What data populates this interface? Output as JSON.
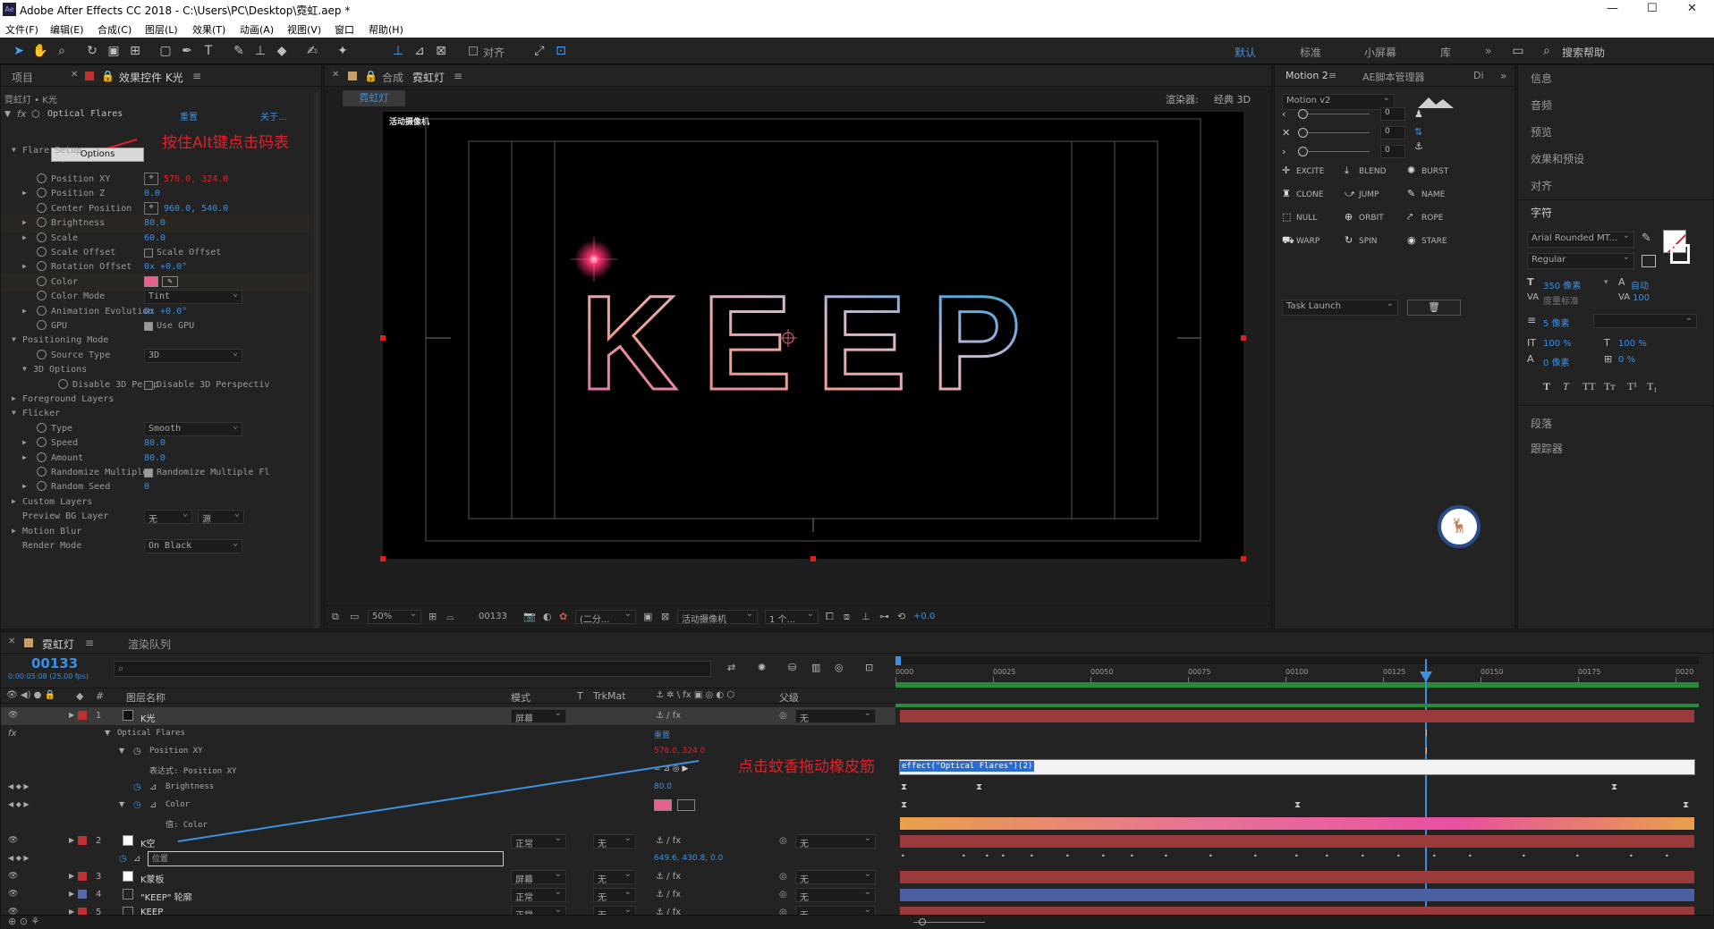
{
  "window": {
    "app_title": "Adobe After Effects CC 2018 - C:\\Users\\PC\\Desktop\\霓虹.aep *",
    "ae_logo": "Ae",
    "minimize": "—",
    "maximize": "☐",
    "close": "✕"
  },
  "menu": [
    "文件(F)",
    "编辑(E)",
    "合成(C)",
    "图层(L)",
    "效果(T)",
    "动画(A)",
    "视图(V)",
    "窗口",
    "帮助(H)"
  ],
  "toolbar": {
    "align_label": "对齐",
    "workspaces": [
      "默认",
      "标准",
      "小屏幕",
      "库"
    ],
    "active_workspace": "默认",
    "search_placeholder": "搜索帮助"
  },
  "effect_panel": {
    "tab_project": "项目",
    "tab_effects": "效果控件 K光",
    "breadcrumb": "霓虹灯 • K光",
    "effect_name": "Optical Flares",
    "reset": "重置",
    "about": "关于...",
    "annotation": "按住Alt键点击码表",
    "options_btn": "Options",
    "rows": [
      {
        "name": "Flare Setup",
        "indent": 1,
        "tw": "open"
      },
      {
        "name": "Position XY",
        "indent": 2,
        "value": "576.0, 324.0",
        "red": true,
        "target": true,
        "watch": true
      },
      {
        "name": "Position Z",
        "indent": 2,
        "tw": "closed",
        "value": "0.0",
        "watch": true
      },
      {
        "name": "Center Position",
        "indent": 2,
        "value": "960.0, 540.0",
        "target": true,
        "watch": true
      },
      {
        "name": "Brightness",
        "indent": 2,
        "tw": "closed",
        "value": "80.0",
        "watch": true,
        "hl": true
      },
      {
        "name": "Scale",
        "indent": 2,
        "tw": "closed",
        "value": "60.0",
        "watch": true
      },
      {
        "name": "Scale Offset",
        "indent": 2,
        "check": "Scale Offset",
        "watch": true
      },
      {
        "name": "Rotation Offset",
        "indent": 2,
        "tw": "closed",
        "value": "0x +0.0°",
        "watch": true
      },
      {
        "name": "Color",
        "indent": 2,
        "swatch": true,
        "watch": true,
        "hl": true
      },
      {
        "name": "Color Mode",
        "indent": 2,
        "select": "Tint",
        "watch": true
      },
      {
        "name": "Animation Evolution",
        "indent": 2,
        "tw": "closed",
        "value": "0x +0.0°",
        "watch": true
      },
      {
        "name": "GPU",
        "indent": 2,
        "check": "Use GPU",
        "on": true,
        "watch": true
      },
      {
        "name": "Positioning Mode",
        "indent": 1,
        "tw": "open"
      },
      {
        "name": "Source Type",
        "indent": 2,
        "select": "3D",
        "watch": true
      },
      {
        "name": "3D Options",
        "indent": 2,
        "tw": "open"
      },
      {
        "name": "Disable 3D Persp",
        "indent": 4,
        "check": "Disable 3D Perspectiv",
        "watch": true
      },
      {
        "name": "Foreground Layers",
        "indent": 1,
        "tw": "closed"
      },
      {
        "name": "Flicker",
        "indent": 1,
        "tw": "open"
      },
      {
        "name": "Type",
        "indent": 2,
        "select": "Smooth",
        "watch": true
      },
      {
        "name": "Speed",
        "indent": 2,
        "tw": "closed",
        "value": "80.0",
        "watch": true
      },
      {
        "name": "Amount",
        "indent": 2,
        "tw": "closed",
        "value": "80.0",
        "watch": true
      },
      {
        "name": "Randomize Multiple",
        "indent": 2,
        "check": "Randomize Multiple Fl",
        "on": true,
        "watch": true
      },
      {
        "name": "Random Seed",
        "indent": 2,
        "tw": "closed",
        "value": "0",
        "watch": true
      },
      {
        "name": "Custom Layers",
        "indent": 1,
        "tw": "closed"
      },
      {
        "name": "Preview BG Layer",
        "indent": 1,
        "select": "无",
        "select2": "源"
      },
      {
        "name": "Motion Blur",
        "indent": 1,
        "tw": "closed"
      },
      {
        "name": "Render Mode",
        "indent": 1,
        "select": "On Black"
      }
    ]
  },
  "comp": {
    "tab_label": "合成",
    "comp_name": "霓虹灯",
    "sub_tab": "霓虹灯",
    "renderer_label": "渲染器:",
    "renderer": "经典 3D",
    "camera_label": "活动摄像机",
    "keep_text": "KEEP",
    "footer": {
      "zoom": "50%",
      "frame": "00133",
      "resolution": "(二分...",
      "camera": "活动摄像机",
      "views": "1 个...",
      "exposure": "+0.0"
    }
  },
  "motion_panel": {
    "tab1": "Motion 2",
    "tab2": "AE脚本管理器",
    "tab3": "Di",
    "version": "Motion v2",
    "slider_vals": [
      "0",
      "0",
      "0"
    ],
    "buttons": [
      [
        "EXCITE",
        "BLEND",
        "BURST"
      ],
      [
        "CLONE",
        "JUMP",
        "NAME"
      ],
      [
        "NULL",
        "ORBIT",
        "ROPE"
      ],
      [
        "WARP",
        "SPIN",
        "STARE"
      ]
    ],
    "task": "Task Launch"
  },
  "right_panel": {
    "items": [
      "信息",
      "音频",
      "预览",
      "效果和预设",
      "对齐"
    ],
    "char_title": "字符",
    "font": "Arial Rounded MT...",
    "style": "Regular",
    "size": "350 像素",
    "leading": "自动",
    "kerning": "度量标准",
    "tracking": "100",
    "stroke": "5 像素",
    "vscale": "100 %",
    "hscale": "100 %",
    "baseline": "0 像素",
    "tsume": "0 %",
    "styles": [
      "T",
      "T",
      "TT",
      "Tт",
      "T¹",
      "T₁"
    ],
    "para": "段落",
    "tracker": "跟踪器"
  },
  "timeline": {
    "tab_comp": "霓虹灯",
    "tab_render": "渲染队列",
    "timecode": "00133",
    "sub_timecode": "0:00:05:08 (25.00 fps)",
    "search_placeholder": "",
    "headers": {
      "name": "图层名称",
      "mode": "模式",
      "t": "T",
      "trkmat": "TrkMat",
      "parent": "父级"
    },
    "ruler": [
      "0000",
      "00025",
      "00050",
      "00075",
      "00100",
      "00125",
      "00150",
      "00175",
      "0020"
    ],
    "annotation": "点击蚊香拖动橡皮筋",
    "expression_text": "effect(\"Optical Flares\")(2)",
    "rows": {
      "l1": {
        "num": "1",
        "name": "K光",
        "mode": "屏幕",
        "parent": "无"
      },
      "effect": "Optical Flares",
      "effect_reset": "重置",
      "pos": "Position XY",
      "pos_val": "576.0, 324.0",
      "expr_label": "表达式: Position XY",
      "brightness": "Brightness",
      "brightness_val": "80.0",
      "color": "Color",
      "color_expr": "值: Color",
      "l2": {
        "num": "2",
        "name": "K空",
        "mode": "正常",
        "trk": "无",
        "parent": "无"
      },
      "l2_prop": "位置",
      "l2_val": "649.6, 430.8, 0.0",
      "l3": {
        "num": "3",
        "name": "K蒙板",
        "mode": "屏幕",
        "trk": "无",
        "parent": "无"
      },
      "l4": {
        "num": "4",
        "name": "\"KEEP\" 轮廓",
        "mode": "正常",
        "trk": "无",
        "parent": "无"
      },
      "l5": {
        "num": "5",
        "name": "KEEP",
        "mode": "正常",
        "trk": "无",
        "parent": "无"
      }
    }
  },
  "colors": {
    "accent": "#2d8ceb",
    "red": "#e0202a",
    "layer_red": "#b03a3a",
    "layer_blue": "#4a5fa0",
    "orange": "#e8a04a",
    "pink": "#e8509a"
  }
}
